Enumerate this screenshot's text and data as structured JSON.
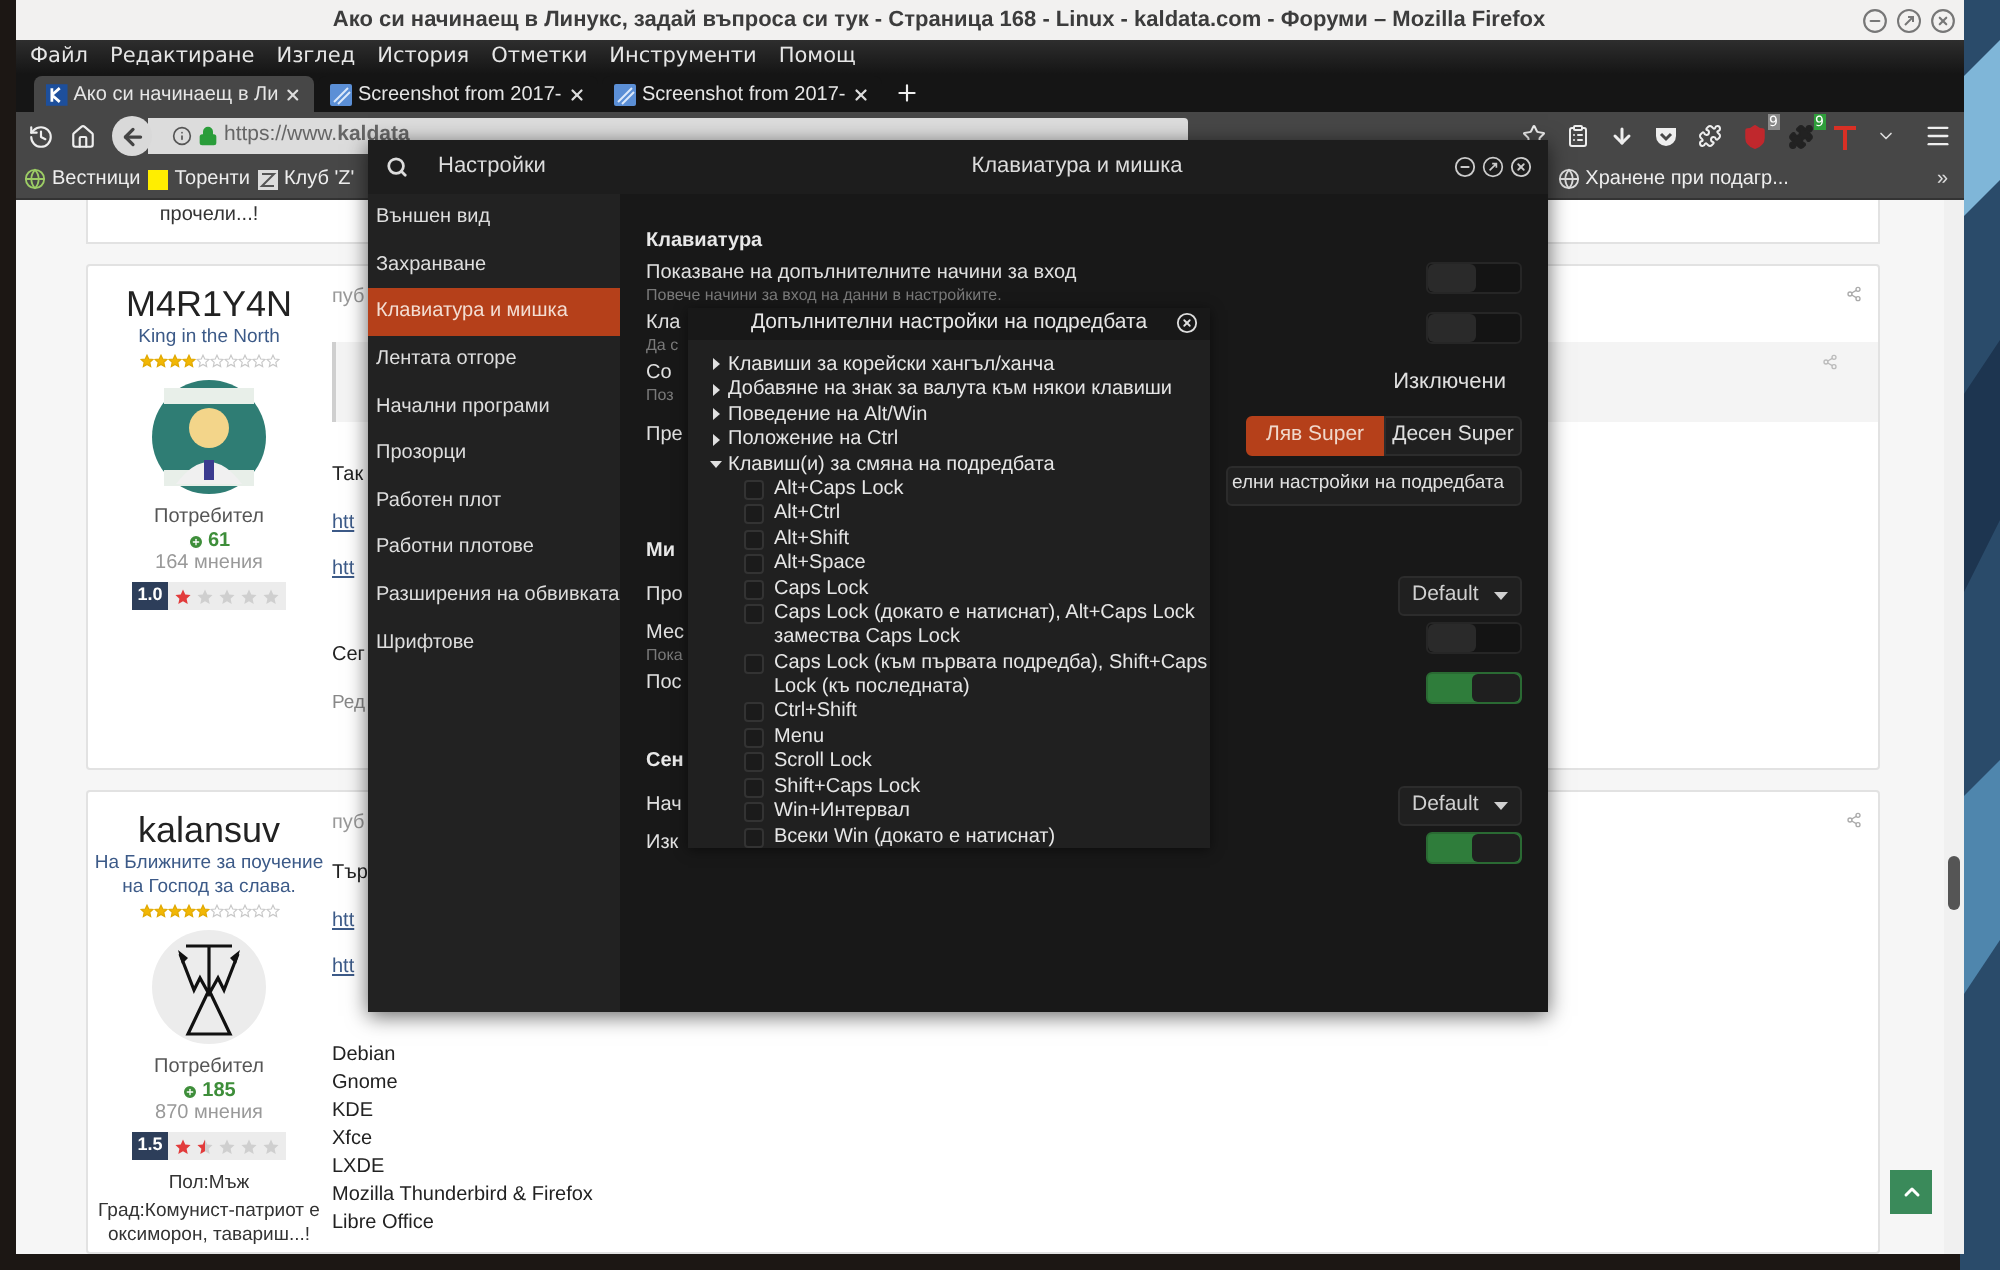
{
  "window": {
    "title": "Ако си начинаещ в Линукс, задай въпроса си тук - Страница 168 - Linux - kaldata.com - Форуми – Mozilla Firefox"
  },
  "menu": [
    "Файл",
    "Редактиране",
    "Изглед",
    "История",
    "Отметки",
    "Инструменти",
    "Помощ"
  ],
  "tabs": [
    {
      "label": "Ако си начинаещ в Ли",
      "selected": true
    },
    {
      "label": "Screenshot from 2017-",
      "selected": false
    },
    {
      "label": "Screenshot from 2017-",
      "selected": false
    }
  ],
  "toolbar": {
    "url": "https://www.**kaldata**",
    "extensions": [
      {
        "badge": "9",
        "color": "#8a8a8a"
      },
      {
        "badge": "9",
        "color": "#2e9e3a"
      }
    ]
  },
  "bookmarks": {
    "items": [
      "Вестници",
      "Торенти",
      "Клуб 'Z'"
    ],
    "right": "Хранене при подагр...",
    "more": "»"
  },
  "page": {
    "fragment": "прочели...!",
    "posts": [
      {
        "author": "M4R1Y4N",
        "title": "King in the North",
        "stars": 4,
        "role": "Потребител",
        "reputation": "61",
        "count": "164 мнения",
        "rating": {
          "value": "1.0",
          "stars": 1
        },
        "header": "пуб",
        "quote": true,
        "body": [
          {
            "kind": "text",
            "text": "Так"
          },
          {
            "kind": "link",
            "text": "htt"
          },
          {
            "kind": "link",
            "text": "htt"
          }
        ],
        "signature": "Сег",
        "edited": "Ред"
      },
      {
        "author": "kalansuv",
        "title": "На Ближните за поучение на Господ за слава.",
        "stars": 5,
        "role": "Потребител",
        "reputation": "185",
        "count": "870 мнения",
        "rating": {
          "value": "1.5",
          "stars": 1.5
        },
        "details": [
          "Пол:Мъж",
          "Град:Комунист-патриот е оксиморон, тавариш...!"
        ],
        "header": "пуб",
        "quote": false,
        "body": [
          {
            "kind": "text",
            "text": "Тър"
          },
          {
            "kind": "link",
            "text": "htt"
          },
          {
            "kind": "link",
            "text": "htt"
          }
        ],
        "list": [
          "Debian",
          "Gnome",
          "KDE",
          "Xfce",
          "LXDE",
          "Mozilla Thunderbird & Firefox",
          "Libre Office"
        ]
      }
    ]
  },
  "settings": {
    "search_title": "Настройки",
    "title": "Клавиатура и мишка",
    "sidebar": [
      {
        "label": "Външен вид",
        "selected": false
      },
      {
        "label": "Захранване",
        "selected": false
      },
      {
        "label": "Клавиатура и мишка",
        "selected": true
      },
      {
        "label": "Лентата отгоре",
        "selected": false
      },
      {
        "label": "Начални програми",
        "selected": false
      },
      {
        "label": "Прозорци",
        "selected": false
      },
      {
        "label": "Работен плот",
        "selected": false
      },
      {
        "label": "Работни плотове",
        "selected": false
      },
      {
        "label": "Разширения на обвивката",
        "selected": false
      },
      {
        "label": "Шрифтове",
        "selected": false
      }
    ],
    "content": [
      {
        "kind": "heading",
        "label": "Клавиатура"
      },
      {
        "kind": "toggle",
        "label": "Показване на допълнителните начини за вход",
        "hint": "Повече начини за вход на данни в настройките.",
        "on": false
      },
      {
        "kind": "toggle",
        "label": "Кла",
        "hint": "Да с",
        "on": false
      },
      {
        "kind": "value",
        "label": "Со",
        "hint": "Поз",
        "value": "Изключени"
      },
      {
        "kind": "segmented",
        "label": "Пре",
        "options": [
          {
            "label": "Ляв Super",
            "selected": true
          },
          {
            "label": "Десен Super",
            "selected": false
          }
        ]
      },
      {
        "kind": "button",
        "label": "елни настройки на подредбата"
      },
      {
        "kind": "heading",
        "label": "Ми"
      },
      {
        "kind": "dropdown",
        "label": "Про",
        "value": "Default"
      },
      {
        "kind": "toggle",
        "label": "Мес",
        "hint": "Пока",
        "on": false
      },
      {
        "kind": "toggle",
        "label": "Пос",
        "on": true
      },
      {
        "kind": "heading",
        "label": "Сен"
      },
      {
        "kind": "dropdown",
        "label": "Нач",
        "value": "Default"
      },
      {
        "kind": "toggle",
        "label": "Изк",
        "on": true
      }
    ]
  },
  "popover": {
    "title": "Допълнителни настройки на подредбата",
    "tree": [
      {
        "label": "Клавиши за корейски хангъл/ханча",
        "expanded": false
      },
      {
        "label": "Добавяне на знак за валута към някои клавиши",
        "expanded": false
      },
      {
        "label": "Поведение на Alt/Win",
        "expanded": false
      },
      {
        "label": "Положение на Ctrl",
        "expanded": false
      },
      {
        "label": "Клавиш(и) за смяна на подредбата",
        "expanded": true,
        "children": [
          {
            "label": "Alt+Caps Lock",
            "checked": false
          },
          {
            "label": "Alt+Ctrl",
            "checked": false
          },
          {
            "label": "Alt+Shift",
            "checked": false
          },
          {
            "label": "Alt+Space",
            "checked": false
          },
          {
            "label": "Caps Lock",
            "checked": false
          },
          {
            "label": "Caps Lock (докато е натиснат), Alt+Caps Lock замества Caps Lock",
            "checked": false
          },
          {
            "label": "Caps Lock (към първата подредба), Shift+Caps Lock (къ последната)",
            "checked": false
          },
          {
            "label": "Ctrl+Shift",
            "checked": false
          },
          {
            "label": "Menu",
            "checked": false
          },
          {
            "label": "Scroll Lock",
            "checked": false
          },
          {
            "label": "Shift+Caps Lock",
            "checked": false
          },
          {
            "label": "Win+Интервал",
            "checked": false
          },
          {
            "label": "Всеки Win (докато е натиснат)",
            "checked": false
          }
        ]
      }
    ]
  }
}
